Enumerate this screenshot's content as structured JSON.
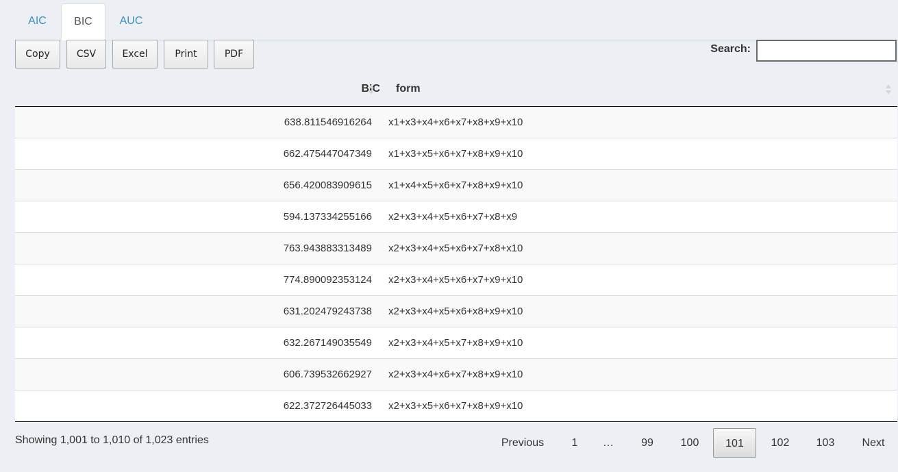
{
  "tabs": [
    {
      "label": "AIC",
      "active": false
    },
    {
      "label": "BIC",
      "active": true
    },
    {
      "label": "AUC",
      "active": false
    }
  ],
  "buttons": [
    "Copy",
    "CSV",
    "Excel",
    "Print",
    "PDF"
  ],
  "search": {
    "label": "Search:",
    "value": ""
  },
  "table": {
    "columns": [
      "BIC",
      "form"
    ],
    "rows": [
      {
        "bic": "638.811546916264",
        "form": "x1+x3+x4+x6+x7+x8+x9+x10"
      },
      {
        "bic": "662.475447047349",
        "form": "x1+x3+x5+x6+x7+x8+x9+x10"
      },
      {
        "bic": "656.420083909615",
        "form": "x1+x4+x5+x6+x7+x8+x9+x10"
      },
      {
        "bic": "594.137334255166",
        "form": "x2+x3+x4+x5+x6+x7+x8+x9"
      },
      {
        "bic": "763.943883313489",
        "form": "x2+x3+x4+x5+x6+x7+x8+x10"
      },
      {
        "bic": "774.890092353124",
        "form": "x2+x3+x4+x5+x6+x7+x9+x10"
      },
      {
        "bic": "631.202479243738",
        "form": "x2+x3+x4+x5+x6+x8+x9+x10"
      },
      {
        "bic": "632.267149035549",
        "form": "x2+x3+x4+x5+x7+x8+x9+x10"
      },
      {
        "bic": "606.739532662927",
        "form": "x2+x3+x4+x6+x7+x8+x9+x10"
      },
      {
        "bic": "622.372726445033",
        "form": "x2+x3+x5+x6+x7+x8+x9+x10"
      }
    ]
  },
  "info": "Showing 1,001 to 1,010 of 1,023 entries",
  "pagination": {
    "previous": "Previous",
    "next": "Next",
    "pages": [
      "1",
      "…",
      "99",
      "100",
      "101",
      "102",
      "103"
    ],
    "current": "101"
  }
}
